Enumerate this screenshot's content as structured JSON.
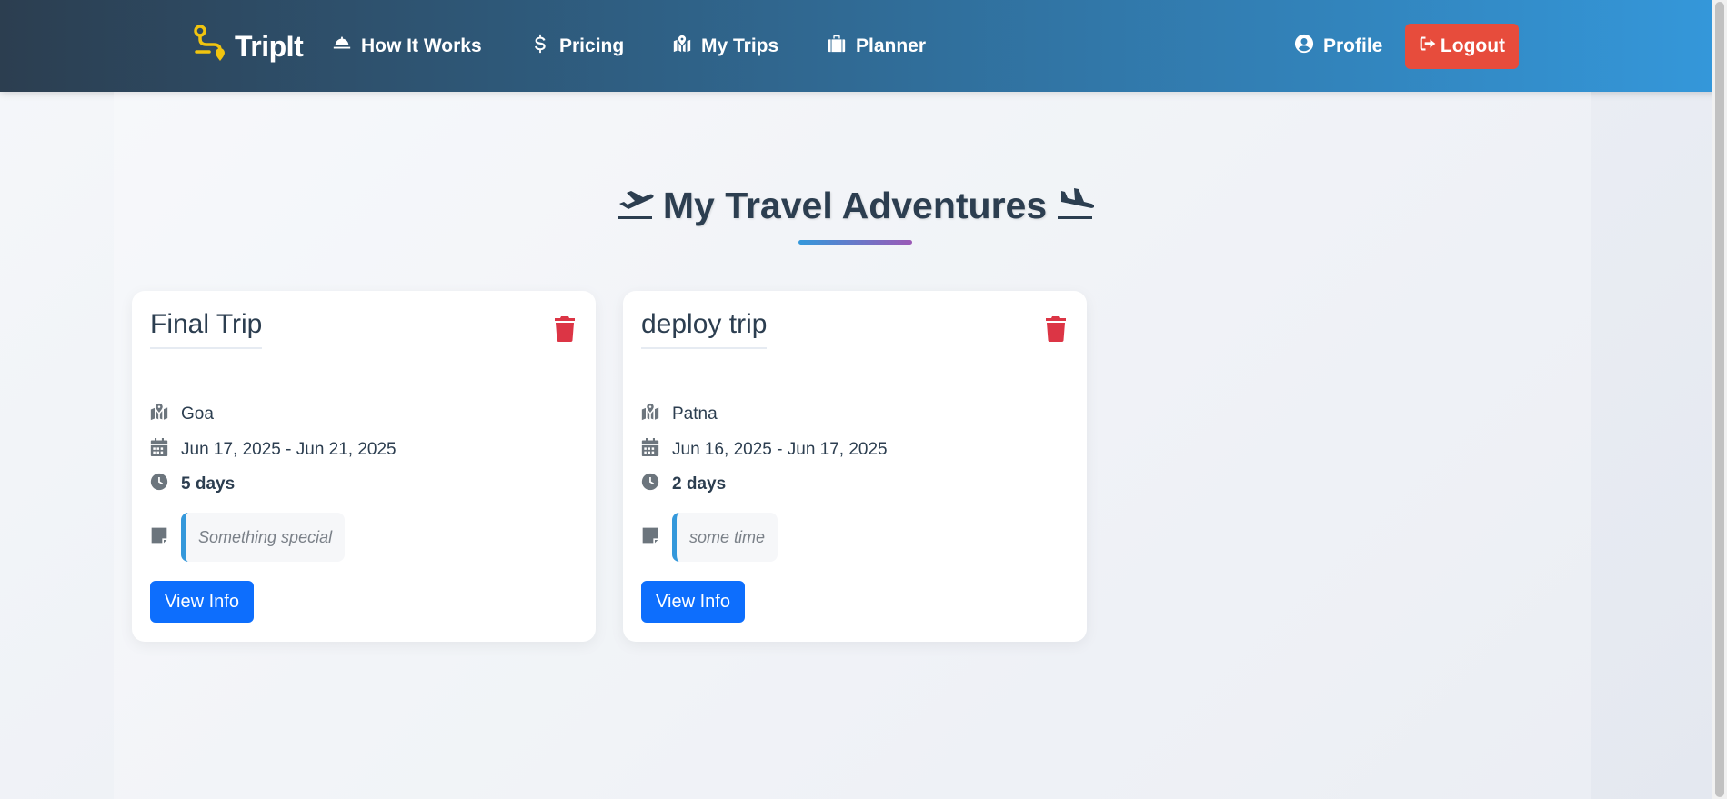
{
  "navbar": {
    "brand": "TripIt",
    "links": [
      {
        "label": "How It Works",
        "icon": "bell-concierge-icon"
      },
      {
        "label": "Pricing",
        "icon": "dollar-icon"
      },
      {
        "label": "My Trips",
        "icon": "map-location-icon"
      },
      {
        "label": "Planner",
        "icon": "suitcase-icon"
      }
    ],
    "profile_label": "Profile",
    "logout_label": "Logout",
    "colors": {
      "gradient_start": "#2c3e50",
      "gradient_end": "#3498db",
      "logout": "#e74c3c",
      "brand_icon": "#f1c40f"
    }
  },
  "page": {
    "title": "My Travel Adventures"
  },
  "trips": [
    {
      "name": "Final Trip",
      "destination": "Goa",
      "dates": "Jun 17, 2025 - Jun 21, 2025",
      "duration": "5 days",
      "notes": "Something special",
      "button": "View Info"
    },
    {
      "name": "deploy trip",
      "destination": "Patna",
      "dates": "Jun 16, 2025 - Jun 17, 2025",
      "duration": "2 days",
      "notes": "some time",
      "button": "View Info"
    }
  ]
}
